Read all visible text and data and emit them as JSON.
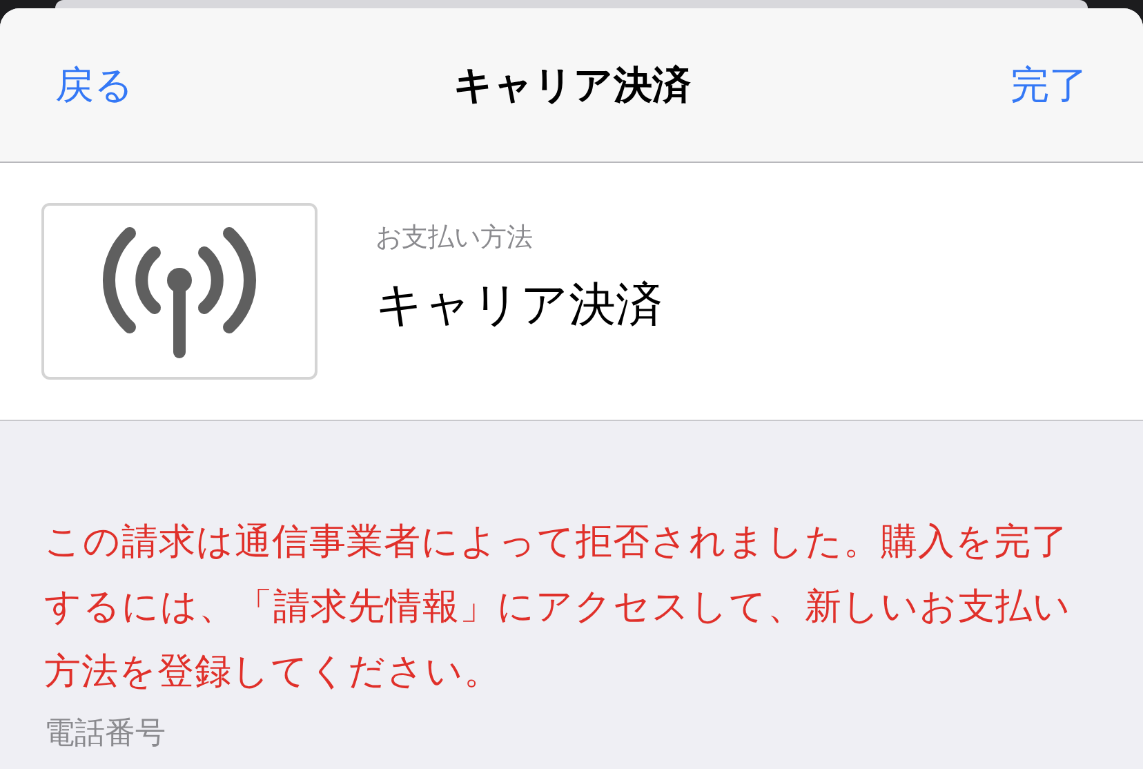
{
  "nav": {
    "back": "戻る",
    "title": "キャリア決済",
    "done": "完了"
  },
  "payment": {
    "label": "お支払い方法",
    "value": "キャリア決済"
  },
  "error_message": "この請求は通信事業者によって拒否されました。購入を完了するには、「請求先情報」にアクセスして、新しいお支払い方法を登録してください。",
  "phone_label": "電話番号"
}
